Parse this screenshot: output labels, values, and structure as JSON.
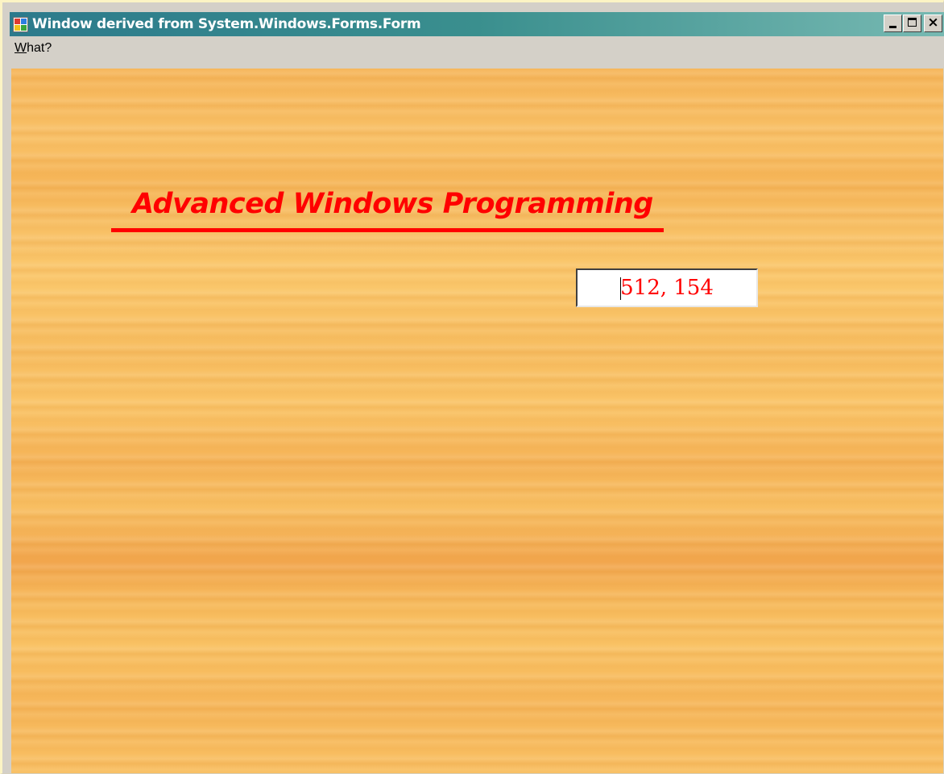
{
  "window": {
    "title": "Window derived from System.Windows.Forms.Form",
    "icon": "windows-app-icon",
    "caption_buttons": {
      "minimize": "minimize-icon",
      "maximize": "maximize-icon",
      "close": "close-icon",
      "close_glyph": "×"
    }
  },
  "menu": {
    "items": [
      {
        "accel": "W",
        "rest": "hat?"
      }
    ]
  },
  "content": {
    "heading": "Advanced Windows Programming",
    "heading_color": "#ff0000",
    "coordinates": "512, 154"
  }
}
